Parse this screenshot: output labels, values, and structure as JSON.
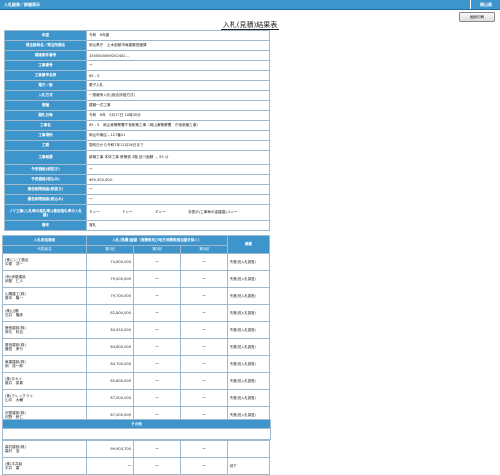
{
  "topbar": {
    "title": "入札結果／詳細表示",
    "right": "岡山県"
  },
  "print_button": "画面印刷",
  "page_title": "入札(見積)結果表",
  "info": [
    {
      "label": "年度",
      "value": "令和　6年度"
    },
    {
      "label": "発注部局名／発注所属名",
      "value": "岡山県庁　土木部都市局建築営繕課"
    },
    {
      "label": "調達案件番号",
      "value": "3300000069202402..."
    },
    {
      "label": "工事番号",
      "value": "ー"
    },
    {
      "label": "工事番号名称",
      "value": "65 - 5"
    },
    {
      "label": "電子／紙",
      "value": "電子入札"
    },
    {
      "label": "入札方式",
      "value": "一般競争入札(総合評価方式)"
    },
    {
      "label": "業種",
      "value": "建築一式工事"
    },
    {
      "label": "開札日時",
      "value": "令和　6年　5月17日 10時30分"
    },
    {
      "label": "工事名",
      "value": "65 - 5　岡山東警察署庁舎新築工事（岡山東警察署　庁舎新築工事）"
    },
    {
      "label": "工事場所",
      "value": "岡山市東区...127番21"
    },
    {
      "label": "工期",
      "value": "契約日から令和7年12月26日まで"
    },
    {
      "label": "工事概要",
      "value": "新築工事 本体工事 鉄骨造 3階 延べ面積 ... 55 ㎡"
    },
    {
      "label": "予定価格(税抜き)",
      "value": "ー"
    },
    {
      "label": "予定価格(税込み)",
      "value": "¥90,300,000-"
    },
    {
      "label": "最低制限価格(税抜き)",
      "value": "ー"
    },
    {
      "label": "最低制限価格(税込み)",
      "value": "ー"
    }
  ],
  "lowest": {
    "label": "ＪＶ工事(入札時の落札率)(最低落札率の入札額)",
    "v1": "Ｘ＝ー",
    "v2": "Ｙ＝ー",
    "v3": "Ｚ＝ー",
    "v4": "非表示(工事毎の金額違い)＝ー"
  },
  "remarks": {
    "label": "備考",
    "value": "落札"
  },
  "bid_table": {
    "col_bidder": "入札参加業者",
    "col_round_group": "入札(見積)金額（消費税及び地方消費税相当額を除く）",
    "col_remark": "摘要",
    "col_name": "代表者名",
    "rounds": [
      "第1回",
      "第2回",
      "第3回"
    ],
    "rows": [
      {
        "name": "(株)○○工務店\n中尾　洋一",
        "r1": "74,800,000",
        "r2": "ー",
        "r3": "ー",
        "remark": "失格(低入札調査)"
      },
      {
        "name": "(有)伊藤建設\n伊藤　仁人",
        "r1": "79,000,000",
        "r2": "ー",
        "r3": "ー",
        "remark": "失格(低入札調査)"
      },
      {
        "name": "山陽建工(株)\n藤本　隆一",
        "r1": "79,700,000",
        "r2": "ー",
        "r3": "ー",
        "remark": "失格(低入札調査)"
      },
      {
        "name": "(株)山陽\n石井　隆彦",
        "r1": "82,800,000",
        "r2": "ー",
        "r3": "ー",
        "remark": "失格(低入札調査)"
      },
      {
        "name": "鹿島建設(株)\n岸元　利治",
        "r1": "84,550,000",
        "r2": "ー",
        "r3": "ー",
        "remark": "失格(低入札調査)"
      },
      {
        "name": "藤田建設(株)\n鎌田　孝行",
        "r1": "84,600,000",
        "r2": "ー",
        "r3": "ー",
        "remark": "失格(低入札調査)"
      },
      {
        "name": "東建建設(株)\n岡　成一郎",
        "r1": "84,700,000",
        "r2": "ー",
        "r3": "ー",
        "remark": "失格(低入札調査)"
      },
      {
        "name": "(株)タカイ\n藤井　英喜",
        "r1": "85,800,000",
        "r2": "ー",
        "r3": "ー",
        "remark": "失格(低入札調査)"
      },
      {
        "name": "(株)クレッグラリ\n山中　大輔",
        "r1": "87,000,000",
        "r2": "ー",
        "r3": "ー",
        "remark": "失格(低入札調査)"
      },
      {
        "name": "沢原建設(株)\n沢野　研仁",
        "r1": "87,000,000",
        "r2": "ー",
        "r3": "ー",
        "remark": "失格(低入札調査)"
      },
      {
        "name": "協和工業(株)\n藤田　功治",
        "r1": "94,200,000",
        "r2": "ー",
        "r3": "ー",
        "remark": "失格(低入札調査)"
      },
      {
        "name": "森村建設(株)\n森村　浩",
        "r1": "99,903,700",
        "r2": "ー",
        "r3": "ー",
        "remark": ""
      },
      {
        "name": "(株)平井組\n平井　康",
        "r1": "ー",
        "r2": "ー",
        "r3": "ー",
        "remark": "辞下"
      }
    ]
  },
  "other": "その他"
}
